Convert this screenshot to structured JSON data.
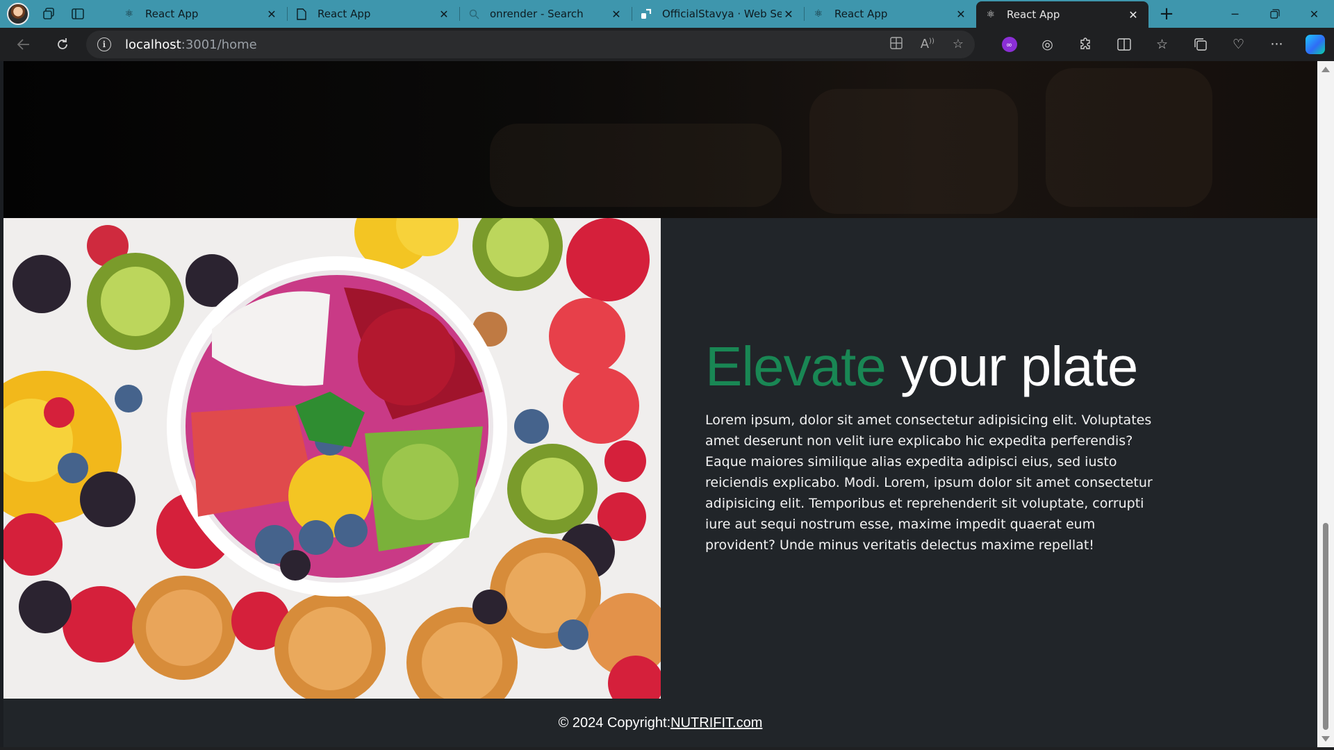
{
  "browser": {
    "tabs": [
      {
        "title": "React App",
        "icon": "react-icon",
        "active": false
      },
      {
        "title": "React App",
        "icon": "page-icon",
        "active": false
      },
      {
        "title": "onrender - Search",
        "icon": "search-icon",
        "active": false
      },
      {
        "title": "OfficialStavya · Web Serv",
        "icon": "render-icon",
        "active": false
      },
      {
        "title": "React App",
        "icon": "react-icon",
        "active": false
      },
      {
        "title": "React App",
        "icon": "react-icon",
        "active": true
      }
    ],
    "address": {
      "host": "localhost",
      "rest": ":3001/home"
    },
    "accent_color": "#3e96ad"
  },
  "page": {
    "heading_accent": "Elevate",
    "heading_rest": " your plate",
    "heading_accent_color": "#198754",
    "paragraph": "Lorem ipsum, dolor sit amet consectetur adipisicing elit. Voluptates amet deserunt non velit iure explicabo hic expedita perferendis? Eaque maiores similique alias expedita adipisci eius, sed iusto reiciendis explicabo. Modi. Lorem, ipsum dolor sit amet consectetur adipisicing elit. Temporibus et reprehenderit sit voluptate, corrupti iure aut sequi nostrum esse, maxime impedit quaerat eum provident? Unde minus veritatis delectus maxime repellat!",
    "footer_prefix": "© 2024 Copyright:",
    "footer_link": "NUTRIFIT.com"
  }
}
